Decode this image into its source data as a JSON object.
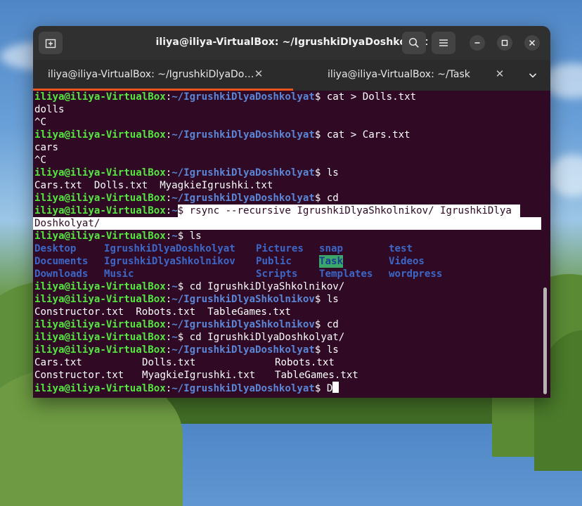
{
  "window": {
    "title": "iliya@iliya-VirtualBox: ~/IgrushkiDlyaDoshkolyat"
  },
  "tabs": [
    {
      "label": "iliya@iliya-VirtualBox: ~/IgrushkiDlyaDo…",
      "active": true
    },
    {
      "label": "iliya@iliya-VirtualBox: ~/Task",
      "active": false
    }
  ],
  "icons": {
    "new_tab": "new-tab-icon",
    "search": "search-icon",
    "menu": "hamburger-menu-icon",
    "minimize": "minimize-icon",
    "maximize": "maximize-icon",
    "close": "close-icon",
    "tab_close": "tab-close-icon",
    "tabs_dropdown": "chevron-down-icon"
  },
  "colors": {
    "terminal_bg": "#300a24",
    "prompt_user": "#55e640",
    "prompt_path": "#5b86d6",
    "directory": "#3d67c7",
    "accent": "#e95420"
  },
  "terminal": {
    "user": "iliya@iliya-VirtualBox",
    "lines": {
      "l0": {
        "sep": ":",
        "path": "~/IgrushkiDlyaDoshkolyat",
        "cmd": "$ cat > Dolls.txt"
      },
      "l1": "dolls",
      "l2": "^C",
      "l3": {
        "sep": ":",
        "path": "~/IgrushkiDlyaDoshkolyat",
        "cmd": "$ cat > Cars.txt"
      },
      "l4": "cars",
      "l5": "^C",
      "l6": {
        "sep": ":",
        "path": "~/IgrushkiDlyaDoshkolyat",
        "cmd": "$ ls"
      },
      "l7": "Cars.txt  Dolls.txt  MyagkieIgrushki.txt",
      "l8": {
        "sep": ":",
        "path": "~/IgrushkiDlyaDoshkolyat",
        "cmd": "$ cd"
      },
      "l9": {
        "sep": ":",
        "path": "~",
        "cmd": "$ rsync --recursive IgrushkiDlyaShkolnikov/ IgrushkiDlya"
      },
      "l10": "Doshkolyat/",
      "l11": {
        "sep": ":",
        "path": "~",
        "cmd": "$ ls"
      },
      "ls_columns": [
        [
          "Desktop",
          "Documents",
          "Downloads"
        ],
        [
          "IgrushkiDlyaDoshkolyat",
          "IgrushkiDlyaShkolnikov",
          "Music"
        ],
        [
          "Pictures",
          "Public",
          "Scripts"
        ],
        [
          "snap",
          "Task",
          "Templates"
        ],
        [
          "test",
          "Videos",
          "wordpress"
        ]
      ],
      "l15": {
        "sep": ":",
        "path": "~",
        "cmd": "$ cd IgrushkiDlyaShkolnikov/"
      },
      "l16": {
        "sep": ":",
        "path": "~/IgrushkiDlyaShkolnikov",
        "cmd": "$ ls"
      },
      "l17": "Constructor.txt  Robots.txt  TableGames.txt",
      "l18": {
        "sep": ":",
        "path": "~/IgrushkiDlyaShkolnikov",
        "cmd": "$ cd"
      },
      "l19": {
        "sep": ":",
        "path": "~",
        "cmd": "$ cd IgrushkiDlyaDoshkolyat/"
      },
      "l20": {
        "sep": ":",
        "path": "~/IgrushkiDlyaDoshkolyat",
        "cmd": "$ ls"
      },
      "l21": [
        "Cars.txt",
        "Dolls.txt",
        "Robots.txt"
      ],
      "l22": [
        "Constructor.txt",
        "MyagkieIgrushki.txt",
        "TableGames.txt"
      ],
      "l23": {
        "sep": ":",
        "path": "~/IgrushkiDlyaDoshkolyat",
        "cmd": "$ D"
      }
    }
  }
}
